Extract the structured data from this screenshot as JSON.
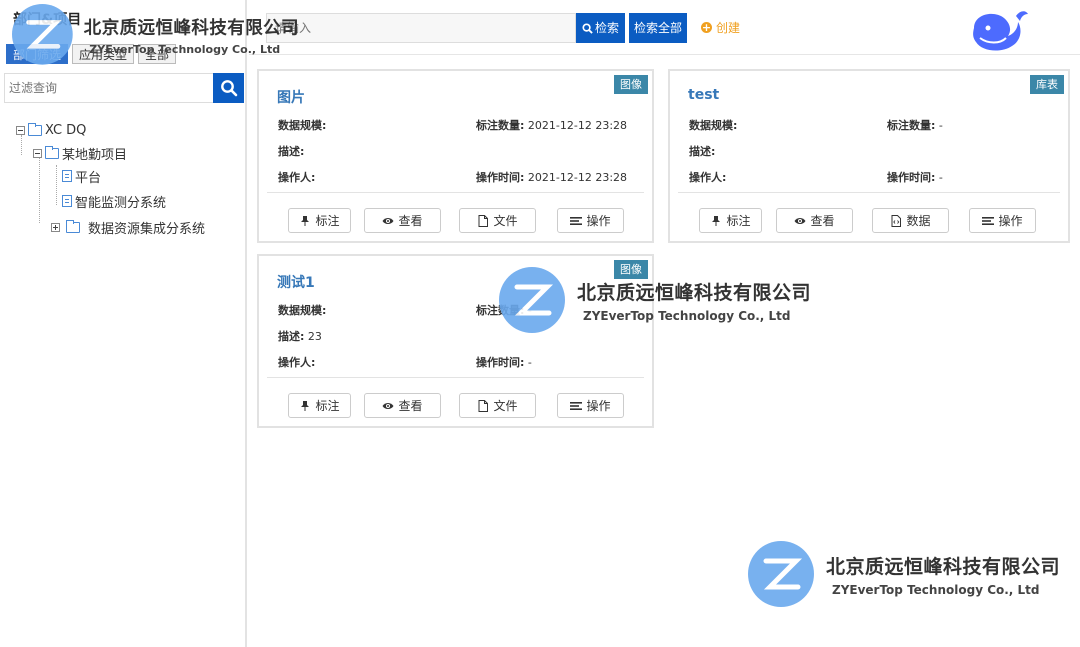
{
  "sidebar": {
    "title": "部门&项目",
    "tabs": [
      "部门筛选",
      "应用类型",
      "全部"
    ],
    "filter_placeholder": "过滤查询",
    "tree": [
      {
        "label": "XC DQ"
      },
      {
        "label": "某地勤项目"
      },
      {
        "label": "平台"
      },
      {
        "label": "智能监测分系统"
      },
      {
        "label": "数据资源集成分系统"
      }
    ]
  },
  "toolbar": {
    "search_placeholder": "请输入",
    "search_label": "检索",
    "search_all_label": "检索全部",
    "create_label": "创建"
  },
  "cards": [
    {
      "badge": "图像",
      "title": "图片",
      "fields": {
        "scale_label": "数据规模:",
        "scale_value": "",
        "count_label": "标注数量:",
        "count_value": "2021-12-12 23:28",
        "desc_label": "描述:",
        "desc_value": "",
        "operator_label": "操作人:",
        "operator_value": "",
        "time_label": "操作时间:",
        "time_value": "2021-12-12 23:28"
      },
      "buttons": [
        "标注",
        "查看",
        "文件",
        "操作"
      ]
    },
    {
      "badge": "库表",
      "title": "test",
      "fields": {
        "scale_label": "数据规模:",
        "scale_value": "",
        "count_label": "标注数量:",
        "count_value": "-",
        "desc_label": "描述:",
        "desc_value": "",
        "operator_label": "操作人:",
        "operator_value": "",
        "time_label": "操作时间:",
        "time_value": "-"
      },
      "buttons": [
        "标注",
        "查看",
        "数据",
        "操作"
      ]
    },
    {
      "badge": "图像",
      "title": "测试1",
      "fields": {
        "scale_label": "数据规模:",
        "scale_value": "",
        "count_label": "标注数量:",
        "count_value": "-",
        "desc_label": "描述:",
        "desc_value": "23",
        "operator_label": "操作人:",
        "operator_value": "",
        "time_label": "操作时间:",
        "time_value": "-"
      },
      "buttons": [
        "标注",
        "查看",
        "文件",
        "操作"
      ]
    }
  ],
  "watermark": {
    "company_cn": "北京质远恒峰科技有限公司",
    "company_en": "ZYEverTop Technology Co., Ltd"
  },
  "colors": {
    "primary": "#0b5cc2",
    "badge": "#3b87a8",
    "title_link": "#3778b8",
    "create": "#f0a020"
  }
}
